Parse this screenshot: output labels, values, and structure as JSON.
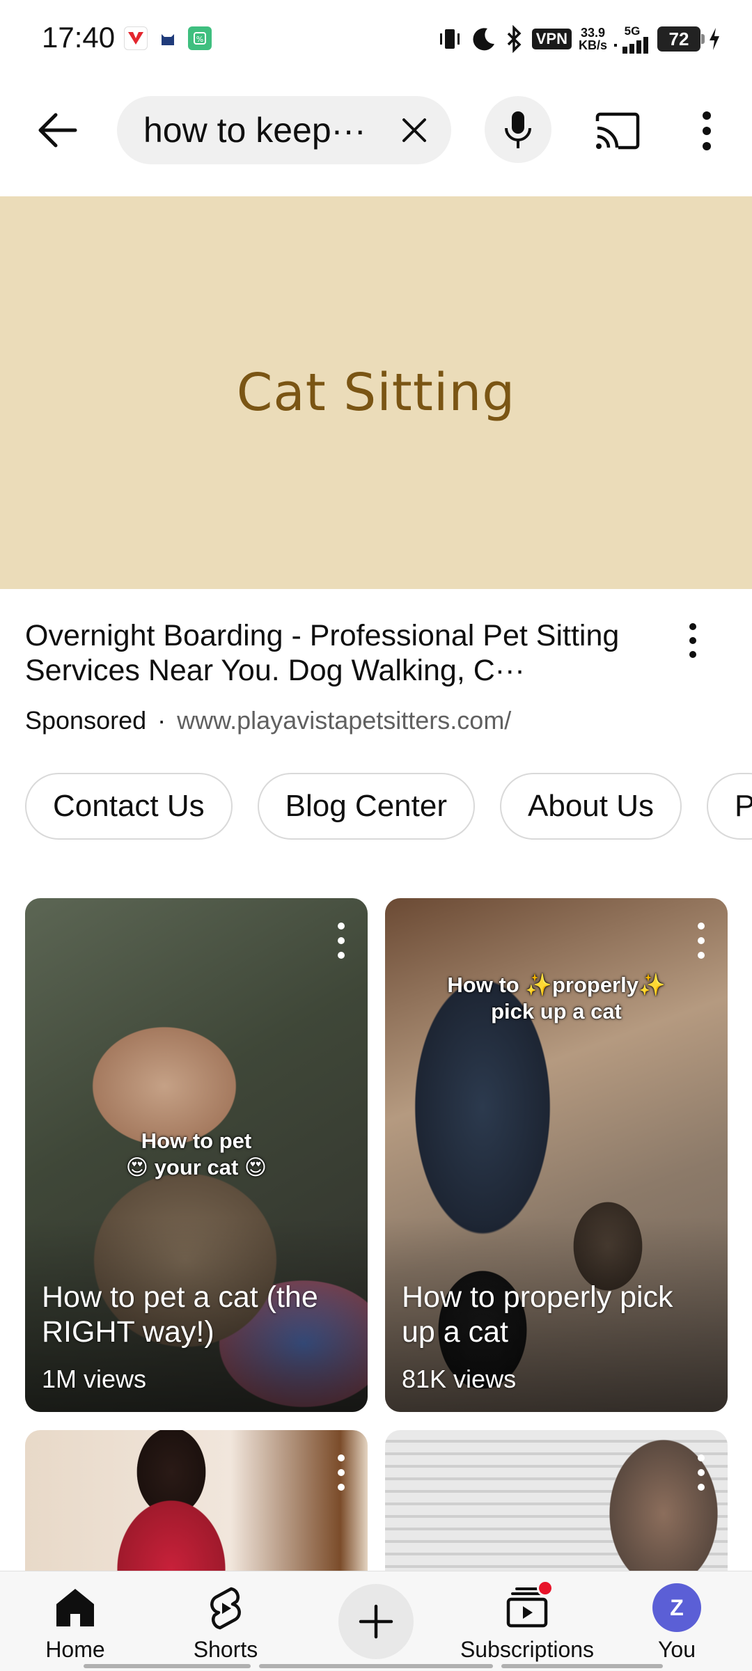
{
  "status_bar": {
    "time": "17:40",
    "vpn": "VPN",
    "speed_value": "33.9",
    "speed_unit": "KB/s",
    "network": "5G",
    "battery": "72"
  },
  "search": {
    "query": "how to keep···"
  },
  "ad": {
    "banner_title": "Cat Sitting",
    "title": "Overnight Boarding - Professional Pet Sitting Services Near You. Dog Walking, C···",
    "sponsored": "Sponsored",
    "separator": "·",
    "url": "www.playavistapetsitters.com/",
    "chips": [
      "Contact Us",
      "Blog Center",
      "About Us",
      "P"
    ]
  },
  "videos": [
    {
      "overlay_line1": "How to pet",
      "overlay_line2": "😍 your cat 😍",
      "title": "How to pet a cat (the RIGHT way!)",
      "views": "1M views"
    },
    {
      "overlay_line1": "How to ✨properly✨",
      "overlay_line2": "pick up a cat",
      "title": "How to properly pick up a cat",
      "views": "81K views"
    }
  ],
  "nav": {
    "home": "Home",
    "shorts": "Shorts",
    "subscriptions": "Subscriptions",
    "you": "You",
    "avatar_letter": "Z"
  },
  "colors": {
    "banner_bg": "#ebdcb9",
    "banner_text": "#7a5514",
    "avatar_bg": "#5b5fd6",
    "notification": "#e8152b"
  }
}
